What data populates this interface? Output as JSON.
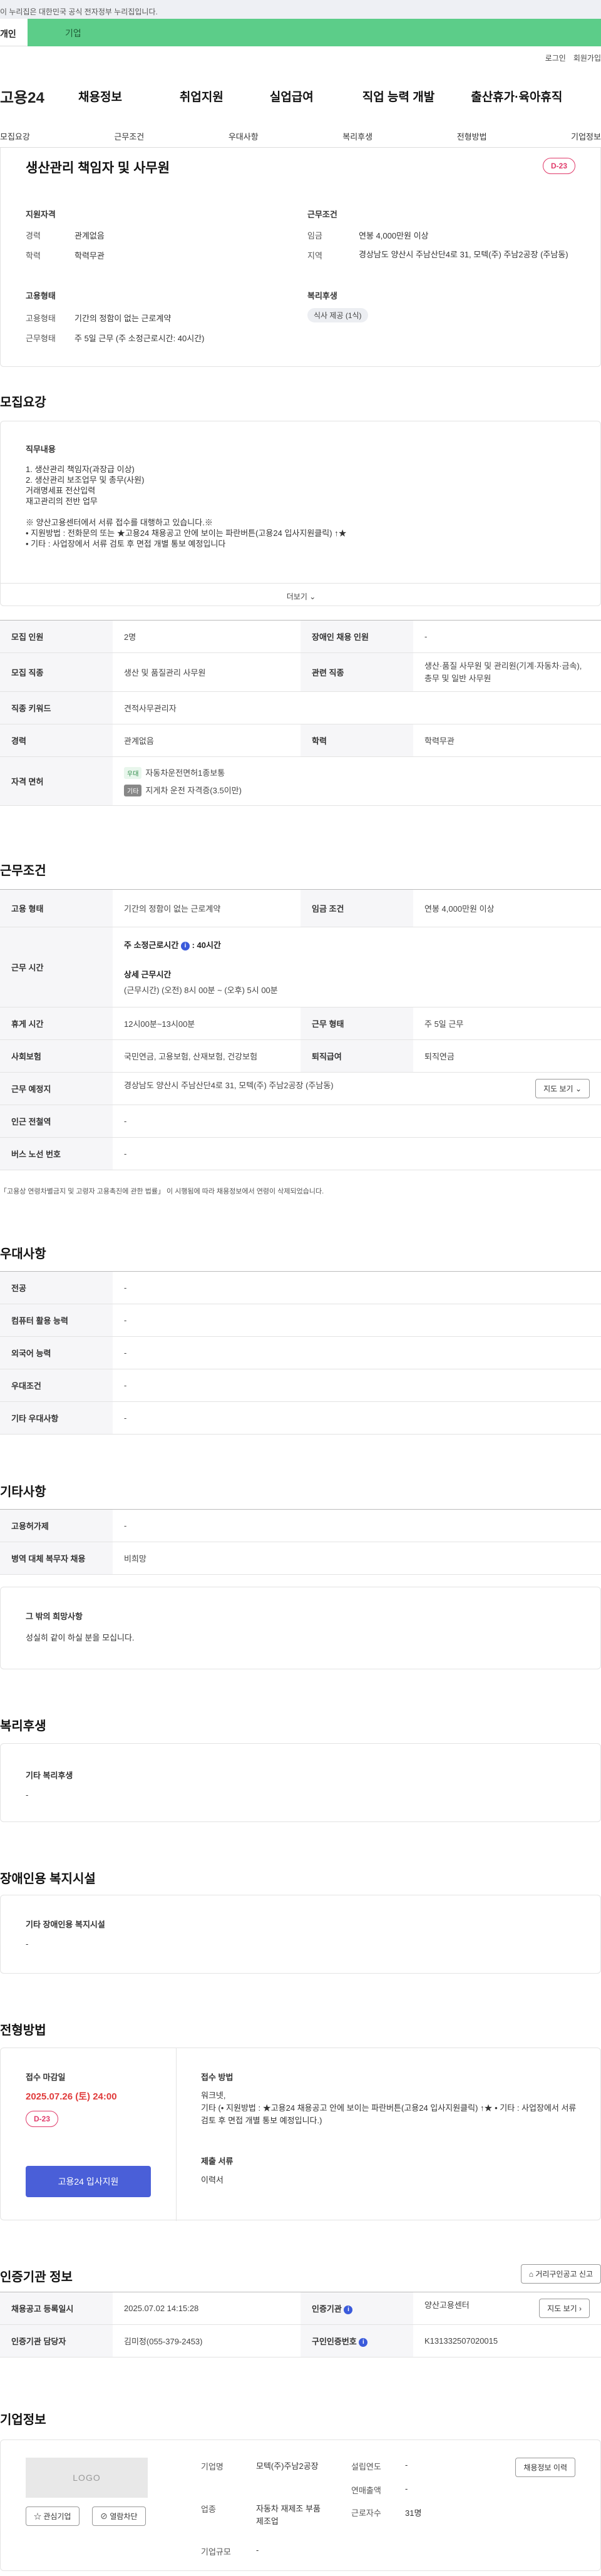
{
  "gov_bar": "이 누리집은 대한민국 공식 전자정부 누리집입니다.",
  "top_tabs": {
    "personal": "개인",
    "company": "기업"
  },
  "util": {
    "login": "로그인",
    "join": "회원가입"
  },
  "gnb": {
    "logo": "고용24",
    "menu": [
      "채용정보",
      "취업지원",
      "실업급여",
      "직업 능력 개발",
      "출산휴가·육아휴직"
    ]
  },
  "subnav": [
    "모집요강",
    "근무조건",
    "우대사항",
    "복리후생",
    "전형방법",
    "기업정보"
  ],
  "summary": {
    "title": "생산관리 책임자 및 사무원",
    "dday": "D-23",
    "qual_heading": "지원자격",
    "career_label": "경력",
    "career_value": "관계없음",
    "edu_label": "학력",
    "edu_value": "학력무관",
    "cond_heading": "근무조건",
    "wage_label": "임금",
    "wage_value": "연봉 4,000만원 이상",
    "region_label": "지역",
    "region_value": "경상남도 양산시 주남산단4로 31, 모텍(주) 주남2공장 (주남동)",
    "emp_heading": "고용형태",
    "emp_type_label": "고용형태",
    "emp_type_value": "기간의 정함이 없는 근로계약",
    "work_label": "근무형태",
    "work_value": "주 5일 근무 (주 소정근로시간: 40시간)",
    "welfare_heading": "복리후생",
    "welfare_chip": "식사 제공 (1식)"
  },
  "recruit": {
    "heading": "모집요강",
    "job_heading": "직무내용",
    "job_text": "1. 생산관리 책임자(과장급 이상)\n2. 생산관리 보조업무 및 총무(사원)\n   거래명세표 전산입력\n   재고관리의 전반 업무\n\n※ 양산고용센터에서 서류 접수를 대행하고 있습니다.※\n• 지원방법 : 전화문의 또는 ★고용24 채용공고 안에 보이는 파란버튼(고용24 입사지원클릭) ↑★\n• 기타 : 사업장에서 서류 검토 후 면접 개별 통보 예정입니다",
    "more": "더보기",
    "rows": {
      "count_label": "모집 인원",
      "count_value": "2명",
      "disabled_label": "장애인 채용 인원",
      "disabled_value": "-",
      "job_label": "모집 직종",
      "job_value": "생산 및 품질관리 사무원",
      "related_label": "관련 직종",
      "related_value": "생산·품질 사무원 및 관리원(기계·자동차·금속), 총무 및 일반 사무원",
      "keyword_label": "직종 키워드",
      "keyword_value": "견적사무관리자",
      "career_label": "경력",
      "career_value": "관계없음",
      "edu_label": "학력",
      "edu_value": "학력무관",
      "license_label": "자격 면허",
      "license_1_tag": "우대",
      "license_1": "자동차운전면허1종보통",
      "license_2_tag": "기타",
      "license_2": "지게차 운전 자격증(3.5이만)"
    }
  },
  "conditions": {
    "heading": "근무조건",
    "emp_label": "고용 형태",
    "emp_value": "기간의 정함이 없는 근로계약",
    "wage_label": "임금 조건",
    "wage_value": "연봉 4,000만원 이상",
    "time_label": "근무 시간",
    "time_weekly": "주 소정근로시간",
    "time_weekly_value": ": 40시간",
    "time_detail_title": "상세 근무시간",
    "time_detail": "(근무시간) (오전) 8시 00분 ~ (오후) 5시 00분",
    "rest_label": "휴게 시간",
    "rest_value": "12시00분~13시00분",
    "worktype_label": "근무 형태",
    "worktype_value": "주 5일 근무",
    "ins_label": "사회보험",
    "ins_value": "국민연금, 고용보험, 산재보험, 건강보험",
    "retire_label": "퇴직급여",
    "retire_value": "퇴직연금",
    "place_label": "근무 예정지",
    "place_value": "경상남도 양산시 주남산단4로 31, 모텍(주) 주남2공장 (주남동)",
    "map_btn": "지도 보기",
    "subway_label": "인근 전철역",
    "subway_value": "-",
    "bus_label": "버스 노선 번호",
    "bus_value": "-",
    "note": "「고용상 연령차별금지 및 고령자 고용촉진에 관한 법률」 이 시행됨에 따라 채용정보에서 연령이 삭제되었습니다."
  },
  "preference": {
    "heading": "우대사항",
    "major_label": "전공",
    "major_value": "-",
    "computer_label": "컴퓨터 활용 능력",
    "computer_value": "-",
    "lang_label": "외국어 능력",
    "lang_value": "-",
    "pref_label": "우대조건",
    "pref_value": "-",
    "other_label": "기타 우대사항",
    "other_value": "-"
  },
  "etc": {
    "heading": "기타사항",
    "mode_label": "고용허가제",
    "mode_value": "-",
    "military_label": "병역 대체 복무자 채용",
    "military_value": "비희망",
    "wish_title": "그 밖의 희망사항",
    "wish_text": "성실히 같이 하실 분을 모십니다."
  },
  "welfare": {
    "heading": "복리후생",
    "title": "기타 복리후생",
    "value": "-"
  },
  "disabled": {
    "heading": "장애인용 복지시설",
    "title": "기타 장애인용 복지시설",
    "value": "-"
  },
  "selection": {
    "heading": "전형방법",
    "deadline_label": "접수 마감일",
    "deadline": "2025.07.26 (토) 24:00",
    "dday": "D-23",
    "apply_btn": "고용24 입사지원",
    "method_title": "접수 방법",
    "method_text": "워크넷,\n기타 (• 지원방법 : ★고용24 채용공고 안에 보이는 파란버튼(고용24 입사지원클릭) ↑★ • 기타 : 사업장에서 서류 검토 후 면접 개별 통보 예정입니다.)",
    "docs_title": "제출 서류",
    "docs_value": "이력서"
  },
  "certify": {
    "heading": "인증기관 정보",
    "map_btn": "거리구인공고 신고",
    "reg_label": "채용공고 등록일시",
    "reg_value": "2025.07.02 14:15:28",
    "agency_label": "인증기관",
    "agency_value": "양산고용센터",
    "agency_btn": "지도 보기",
    "manager_label": "인증기관 담당자",
    "manager_value": "김미정(055-379-2453)",
    "reqno_label": "구인인증번호",
    "reqno_value": "K131332507020015"
  },
  "company": {
    "heading": "기업정보",
    "logo_text": "LOGO",
    "fav_btn": "관심기업",
    "visit_btn": "열람차단",
    "name_label": "기업명",
    "name_value": "모텍(주)주남2공장",
    "industry_label": "업종",
    "industry_value": "자동차 재제조 부품 제조업",
    "size_label": "기업규모",
    "size_value": "-",
    "founded_label": "설립연도",
    "founded_value": "-",
    "revenue_label": "연매출액",
    "revenue_value": "-",
    "employees_label": "근로자수",
    "employees_value": "31명",
    "info_btn": "채용정보 이력"
  }
}
